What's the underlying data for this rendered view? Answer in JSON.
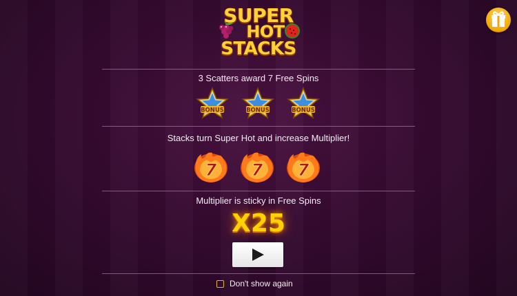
{
  "logo": {
    "line1": "SUPER",
    "line2": "HOT",
    "line3": "STACKS"
  },
  "sections": [
    {
      "caption": "3 Scatters award 7 Free Spins",
      "icon": "bonus-star-icon",
      "icon_label": "BONUS",
      "icon_count": 3
    },
    {
      "caption": "Stacks turn Super Hot and increase Multiplier!",
      "icon": "flaming-seven-icon",
      "icon_label": "7",
      "icon_count": 3
    },
    {
      "caption": "Multiplier is sticky in Free Spins"
    }
  ],
  "multiplier": "X25",
  "play_button": {
    "icon": "play-icon"
  },
  "dont_show": {
    "label": "Don't show again",
    "checked": false
  },
  "gift_button": {
    "icon": "gift-icon"
  },
  "colors": {
    "background": "#350a30",
    "gold": "#ffd23a",
    "multiplier": "#ffd200",
    "checkbox_border": "#e9b526",
    "divider": "#c8a8c8"
  }
}
